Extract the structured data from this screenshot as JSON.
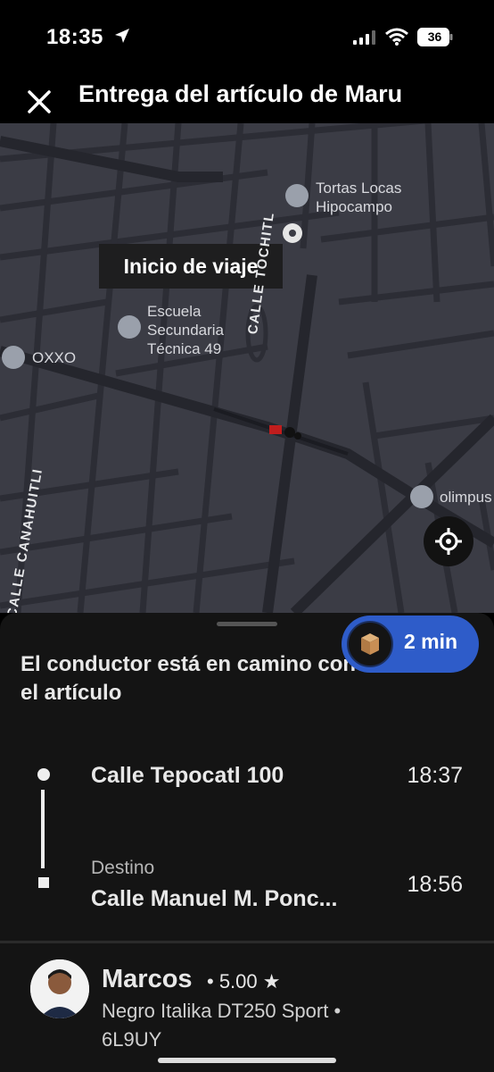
{
  "status_bar": {
    "time": "18:35",
    "battery_level": "36",
    "icons": [
      "location-arrow-icon",
      "signal-icon",
      "wifi-icon",
      "battery-icon"
    ]
  },
  "header": {
    "title": "Entrega del artículo de Maru",
    "close_icon": "close-icon"
  },
  "map": {
    "trip_start_label": "Inicio de viaje",
    "pois": [
      {
        "name_line1": "Tortas Locas",
        "name_line2": "Hipocampo",
        "icon": "restaurant-icon"
      },
      {
        "name_line1": "Escuela",
        "name_line2": "Secundaria",
        "name_line3": "Técnica 49",
        "icon": "school-icon"
      },
      {
        "name_line1": "OXXO",
        "icon": "pin-icon"
      },
      {
        "name_line1": "olimpus",
        "icon": "gym-icon"
      }
    ],
    "streets": [
      "CALLE TOCHITL",
      "CALLE CANAHUITLI"
    ],
    "recenter_icon": "crosshair-icon"
  },
  "sheet": {
    "eta": "2 min",
    "message": "El conductor está en camino con el artículo",
    "stops": [
      {
        "address": "Calle Tepocatl 100",
        "time": "18:37"
      },
      {
        "label": "Destino",
        "address": "Calle Manuel M. Ponc...",
        "time": "18:56"
      }
    ]
  },
  "driver": {
    "name": "Marcos",
    "rating": "• 5.00 ★",
    "vehicle": "Negro Italika DT250 Sport •",
    "plate": "6L9UY"
  },
  "colors": {
    "accent": "#2e5cc9",
    "map_background": "#3b3c45",
    "sheet_background": "#141414"
  }
}
